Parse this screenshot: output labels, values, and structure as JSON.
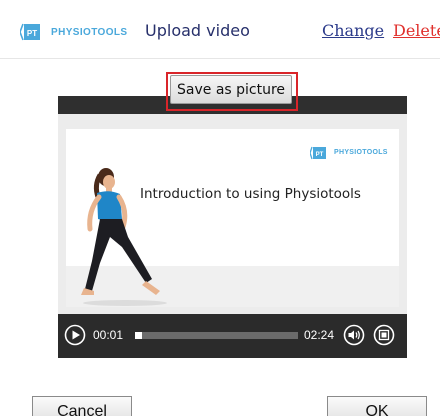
{
  "header": {
    "brand": "PHYSIOTOOLS",
    "brand_mark": "PT",
    "title": "Upload video",
    "change_label": "Change",
    "delete_label": "Delete"
  },
  "actions": {
    "save_as_picture_label": "Save as picture"
  },
  "video": {
    "slide_brand": "PHYSIOTOOLS",
    "slide_brand_mark": "PT",
    "slide_title": "Introduction to using Physiotools",
    "current_time": "00:01",
    "total_time": "02:24",
    "progress_fraction": 0.04
  },
  "footer": {
    "cancel_label": "Cancel",
    "ok_label": "OK"
  },
  "colors": {
    "brand_blue": "#4aa8db",
    "title_navy": "#27306b",
    "link_blue": "#2b3a8a",
    "delete_red": "#e0302c",
    "highlight_red": "#d9252a"
  },
  "icons": {
    "brand": "physiotools-logo-icon",
    "play": "play-icon",
    "volume": "volume-icon",
    "fullscreen": "fullscreen-icon"
  }
}
